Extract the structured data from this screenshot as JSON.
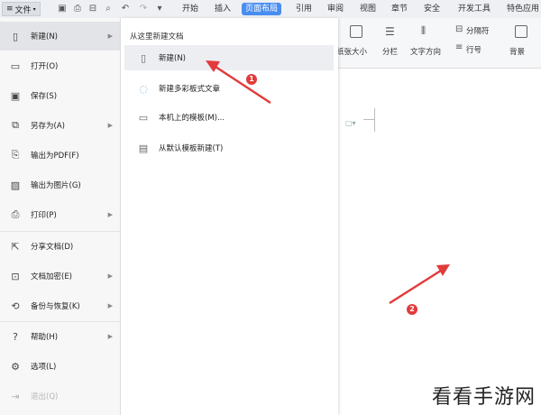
{
  "topbar": {
    "file_label": "文件",
    "tabs": [
      "开始",
      "插入",
      "页面布局",
      "引用",
      "审阅",
      "视图",
      "章节",
      "安全",
      "开发工具",
      "特色应用"
    ],
    "active_tab": "页面布局"
  },
  "ribbon": {
    "items": [
      "纸张大小",
      "分栏",
      "文字方向",
      "分隔符",
      "行号",
      "背景"
    ]
  },
  "left_menu": {
    "items": [
      {
        "label": "新建(N)",
        "icon": "new-doc-icon",
        "arrow": true
      },
      {
        "label": "打开(O)",
        "icon": "folder-icon",
        "arrow": false
      },
      {
        "label": "保存(S)",
        "icon": "save-icon",
        "arrow": false
      },
      {
        "label": "另存为(A)",
        "icon": "save-as-icon",
        "arrow": true
      },
      {
        "label": "输出为PDF(F)",
        "icon": "pdf-icon",
        "arrow": false
      },
      {
        "label": "输出为图片(G)",
        "icon": "image-icon",
        "arrow": false
      },
      {
        "label": "打印(P)",
        "icon": "print-icon",
        "arrow": true
      },
      {
        "label": "分享文档(D)",
        "icon": "share-icon",
        "arrow": false
      },
      {
        "label": "文档加密(E)",
        "icon": "encrypt-icon",
        "arrow": true
      },
      {
        "label": "备份与恢复(K)",
        "icon": "backup-icon",
        "arrow": true
      },
      {
        "label": "帮助(H)",
        "icon": "help-icon",
        "arrow": true
      },
      {
        "label": "选项(L)",
        "icon": "gear-icon",
        "arrow": false
      },
      {
        "label": "退出(Q)",
        "icon": "exit-icon",
        "arrow": false
      }
    ]
  },
  "submenu": {
    "title": "从这里新建文档",
    "items": [
      {
        "label": "新建(N)",
        "icon": "blank-doc-icon"
      },
      {
        "label": "新建多彩板式文章",
        "icon": "colorful-doc-icon"
      },
      {
        "label": "本机上的模板(M)...",
        "icon": "monitor-template-icon"
      },
      {
        "label": "从默认模板新建(T)",
        "icon": "default-template-icon"
      }
    ]
  },
  "annotations": {
    "badge1": "1",
    "badge2": "2",
    "accent": "#e23b3b"
  },
  "watermark": "看看手游网"
}
